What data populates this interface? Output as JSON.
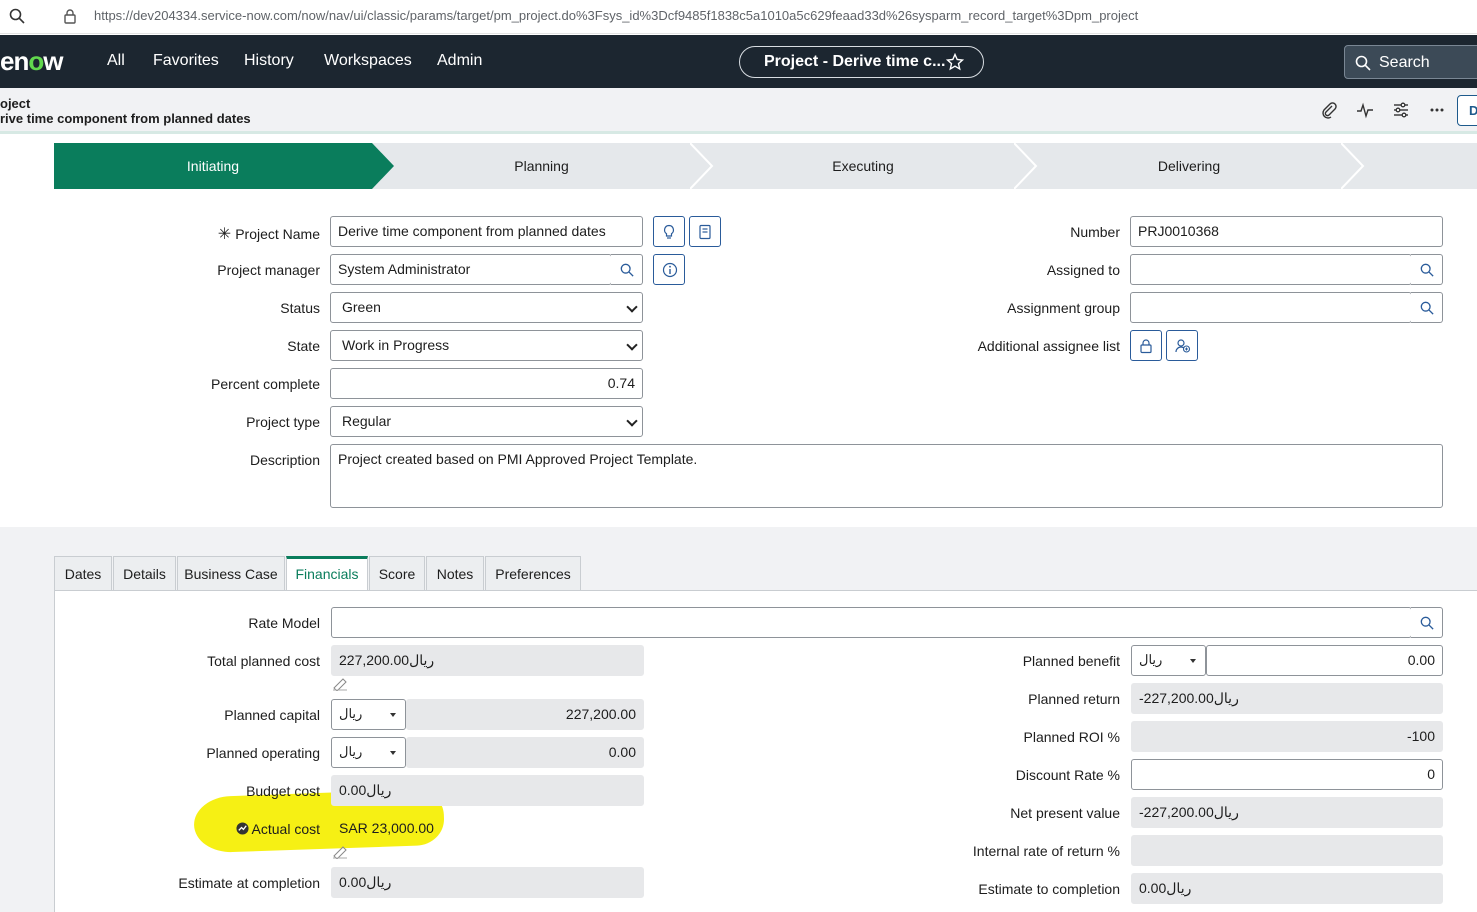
{
  "browser": {
    "url": "https://dev204334.service-now.com/now/nav/ui/classic/params/target/pm_project.do%3Fsys_id%3Dcf9485f1838c5a1010a5c629feaad33d%26sysparm_record_target%3Dpm_project"
  },
  "topnav": {
    "logo_pre": "en",
    "logo_o": "o",
    "logo_post": "w",
    "items": [
      "All",
      "Favorites",
      "History",
      "Workspaces",
      "Admin"
    ],
    "context_pill": "Project - Derive time c...",
    "search_label": "Search"
  },
  "record_header": {
    "line1": "oject",
    "line2": "rive time component from planned dates",
    "action_button": "D"
  },
  "stages": [
    {
      "label": "Initiating",
      "active": true
    },
    {
      "label": "Planning",
      "active": false
    },
    {
      "label": "Executing",
      "active": false
    },
    {
      "label": "Delivering",
      "active": false
    }
  ],
  "form": {
    "project_name_label": "Project Name",
    "project_name": "Derive time component from planned dates",
    "project_manager_label": "Project manager",
    "project_manager": "System Administrator",
    "status_label": "Status",
    "status": "Green",
    "state_label": "State",
    "state": "Work in Progress",
    "percent_complete_label": "Percent complete",
    "percent_complete": "0.74",
    "project_type_label": "Project type",
    "project_type": "Regular",
    "description_label": "Description",
    "description": "Project created based on PMI Approved Project Template.",
    "number_label": "Number",
    "number": "PRJ0010368",
    "assigned_to_label": "Assigned to",
    "assigned_to": "",
    "assignment_group_label": "Assignment group",
    "assignment_group": "",
    "additional_assignee_label": "Additional assignee list"
  },
  "tabs": [
    "Dates",
    "Details",
    "Business Case",
    "Financials",
    "Score",
    "Notes",
    "Preferences"
  ],
  "active_tab": "Financials",
  "financials": {
    "rate_model_label": "Rate Model",
    "rate_model": "",
    "total_planned_cost_label": "Total planned cost",
    "total_planned_cost": "227,200.00ريال",
    "planned_capital_label": "Planned capital",
    "planned_capital_currency": "ريال",
    "planned_capital": "227,200.00",
    "planned_operating_label": "Planned operating",
    "planned_operating_currency": "ريال",
    "planned_operating": "0.00",
    "budget_cost_label": "Budget cost",
    "budget_cost": "0.00ريال",
    "actual_cost_label": "Actual cost",
    "actual_cost": "SAR 23,000.00",
    "estimate_at_completion_label": "Estimate at completion",
    "estimate_at_completion": "0.00ريال",
    "planned_benefit_label": "Planned benefit",
    "planned_benefit_currency": "ريال",
    "planned_benefit": "0.00",
    "planned_return_label": "Planned return",
    "planned_return": "-227,200.00ريال",
    "planned_roi_label": "Planned ROI %",
    "planned_roi": "-100",
    "discount_rate_label": "Discount Rate %",
    "discount_rate": "0",
    "npv_label": "Net present value",
    "npv": "-227,200.00ريال",
    "irr_label": "Internal rate of return %",
    "irr": "",
    "etc_label": "Estimate to completion",
    "etc": "0.00ريال"
  },
  "colors": {
    "nav_bg": "#1c2630",
    "accent": "#0a7d5c",
    "highlight": "#f5ef00"
  }
}
